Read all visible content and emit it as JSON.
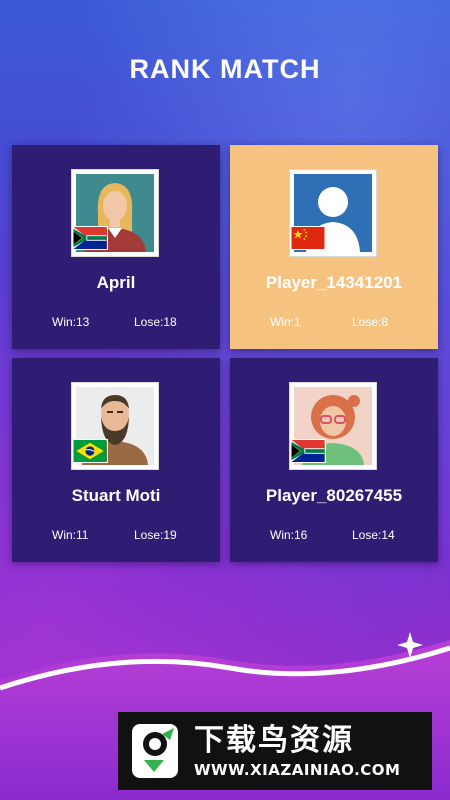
{
  "screen": {
    "title": "RANK MATCH"
  },
  "players": [
    {
      "name": "April",
      "win": "Win:13",
      "lose": "Lose:18",
      "flag": "south-africa-flag",
      "avatar": "woman-blonde-avatar",
      "highlighted": false
    },
    {
      "name": "Player_14341201",
      "win": "Win:1",
      "lose": "Lose:8",
      "flag": "china-flag",
      "avatar": "default-user-avatar",
      "highlighted": true
    },
    {
      "name": "Stuart Moti",
      "win": "Win:11",
      "lose": "Lose:19",
      "flag": "brazil-flag",
      "avatar": "bearded-man-avatar",
      "highlighted": false
    },
    {
      "name": "Player_80267455",
      "win": "Win:16",
      "lose": "Lose:14",
      "flag": "south-africa-flag",
      "avatar": "woman-redhead-glasses-avatar",
      "highlighted": false
    }
  ],
  "watermark": {
    "brand": "下载鸟资源",
    "url": "WWW.XIAZAINIAO.COM"
  },
  "colors": {
    "card": "#2e1d72",
    "card_highlight": "#f6c27f",
    "accent_blue": "#2f6fb5"
  }
}
